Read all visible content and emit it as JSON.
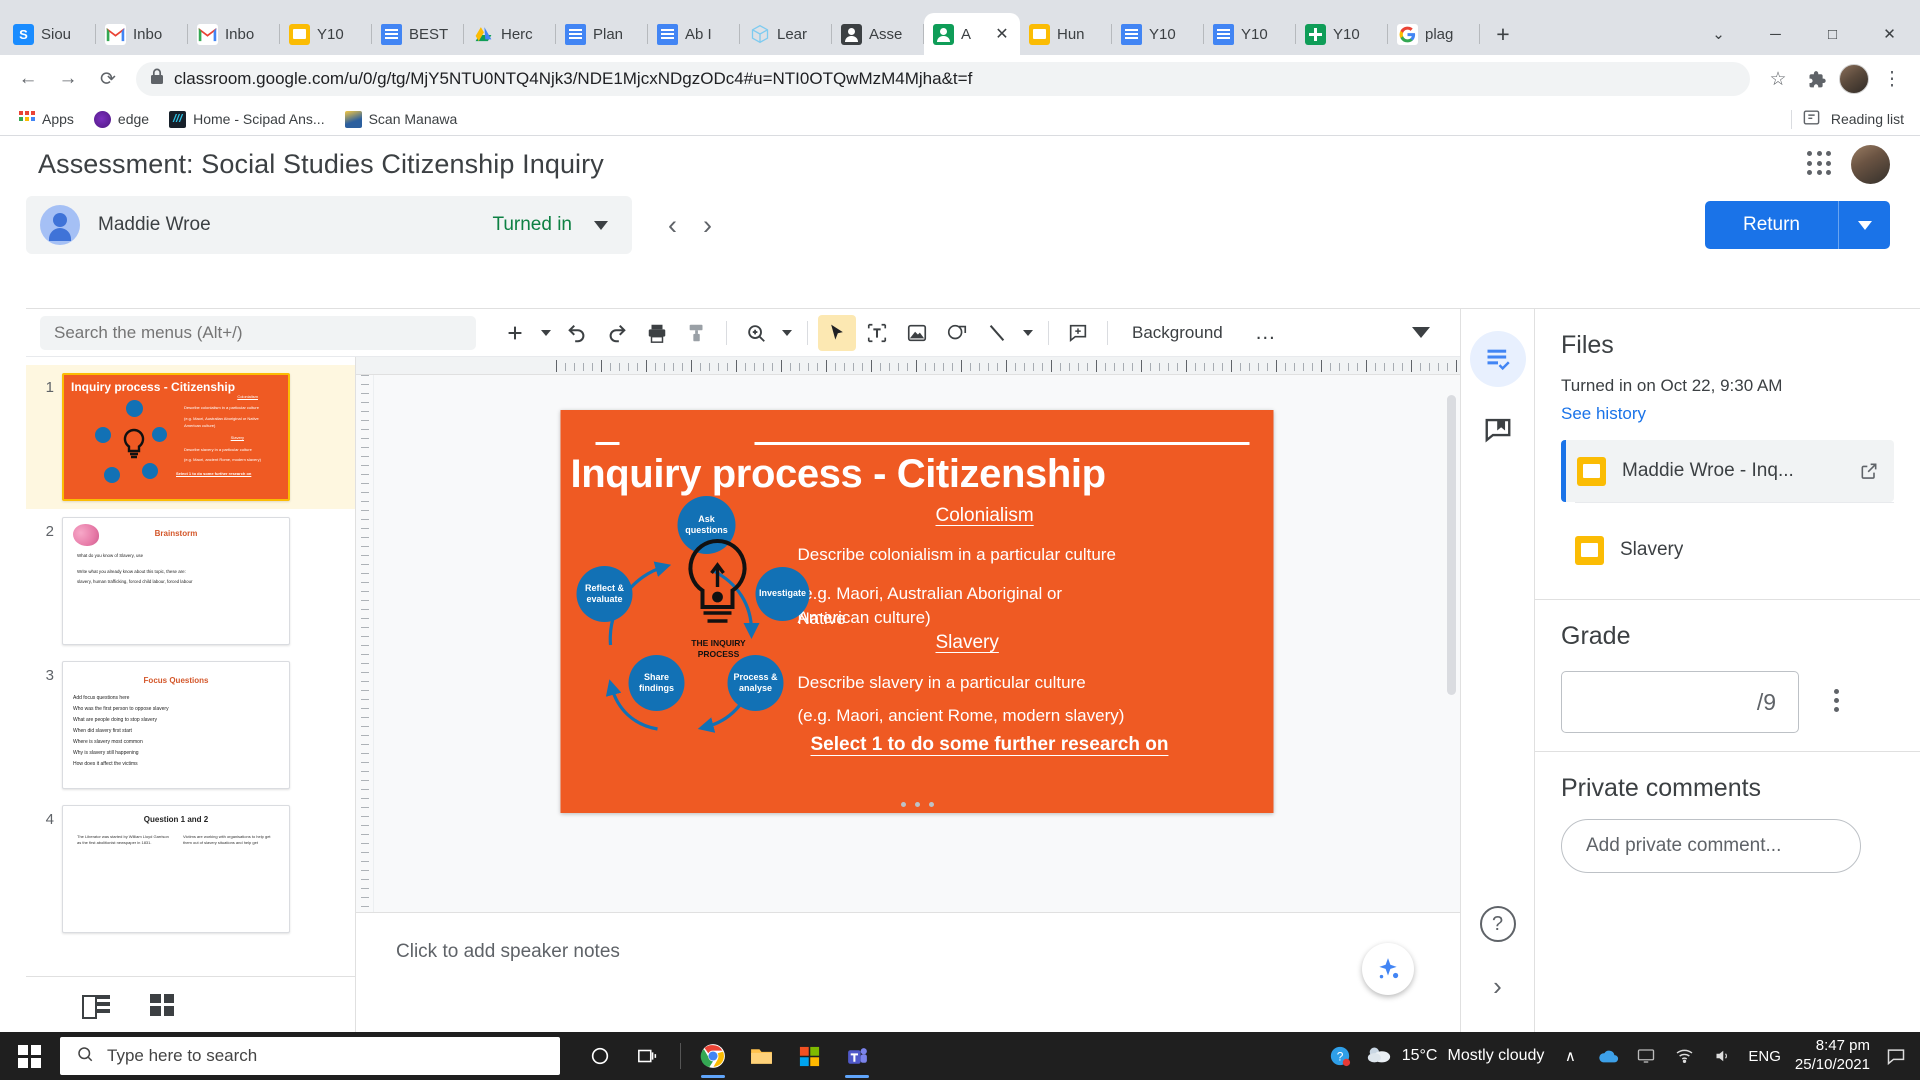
{
  "browser": {
    "tabs": [
      {
        "label": "Siou",
        "icon": "snipping-tool-icon",
        "kind": "snip",
        "active": false
      },
      {
        "label": "Inbo",
        "icon": "gmail-icon",
        "kind": "gmail",
        "active": false
      },
      {
        "label": "Inbo",
        "icon": "gmail-icon",
        "kind": "gmail",
        "active": false
      },
      {
        "label": "Y10",
        "icon": "google-slides-icon",
        "kind": "slides",
        "active": false
      },
      {
        "label": "BEST",
        "icon": "google-docs-icon",
        "kind": "docs",
        "active": false
      },
      {
        "label": "Herc",
        "icon": "google-drive-icon",
        "kind": "drive",
        "active": false
      },
      {
        "label": "Plan",
        "icon": "google-docs-icon",
        "kind": "docs",
        "active": false
      },
      {
        "label": "Ab I",
        "icon": "google-docs-icon",
        "kind": "docs",
        "active": false
      },
      {
        "label": "Lear",
        "icon": "cube-icon",
        "kind": "cube",
        "active": false
      },
      {
        "label": "Asse",
        "icon": "google-classroom-icon",
        "kind": "classroom-grey",
        "active": false
      },
      {
        "label": "A",
        "icon": "google-classroom-icon",
        "kind": "classroom",
        "active": true
      },
      {
        "label": "Hun",
        "icon": "google-slides-icon",
        "kind": "slides",
        "active": false
      },
      {
        "label": "Y10",
        "icon": "google-docs-icon",
        "kind": "docs",
        "active": false
      },
      {
        "label": "Y10",
        "icon": "google-docs-icon",
        "kind": "docs",
        "active": false
      },
      {
        "label": "Y10",
        "icon": "google-sheets-icon",
        "kind": "sheets",
        "active": false
      },
      {
        "label": "plag",
        "icon": "google-search-icon",
        "kind": "google",
        "active": false
      }
    ],
    "new_tab_label": "+",
    "window_controls": {
      "minimize": "─",
      "maximize": "□",
      "close": "✕",
      "chevron": "⌄"
    },
    "url": "classroom.google.com/u/0/g/tg/MjY5NTU0NTQ4Njk3/NDE1MjcxNDgzODc4#u=NTI0OTQwMzM4Mjha&t=f",
    "lock_icon": "lock-icon",
    "back_icon": "←",
    "forward_icon": "→",
    "reload_icon": "⟳",
    "star_icon": "☆",
    "extensions_icon": "puzzle-icon",
    "menu_icon": "⋮",
    "bookmarks": [
      {
        "label": "Apps",
        "icon": "apps-grid-icon"
      },
      {
        "label": "edge",
        "icon": "edge-icon"
      },
      {
        "label": "Home - Scipad Ans...",
        "icon": "scipad-icon"
      },
      {
        "label": "Scan Manawa",
        "icon": "scan-manawa-icon"
      }
    ],
    "reading_list_label": "Reading list",
    "reading_list_icon": "reading-list-icon"
  },
  "classroom": {
    "title": "Assessment: Social Studies Citizenship Inquiry",
    "apps_icon": "google-apps-grid-icon",
    "account_avatar": "account-avatar",
    "student": {
      "name": "Maddie Wroe",
      "status": "Turned in",
      "status_color": "#0d8043",
      "avatar": "student-avatar"
    },
    "prev_icon": "‹",
    "next_icon": "›",
    "return_label": "Return",
    "return_color": "#1a73e8"
  },
  "slides": {
    "search_placeholder": "Search the menus (Alt+/)",
    "toolbar": {
      "add_label": "+",
      "undo_icon": "undo-icon",
      "redo_icon": "redo-icon",
      "print_icon": "print-icon",
      "paint_format_icon": "paint-format-icon",
      "zoom_icon": "zoom-icon",
      "select_icon": "select-cursor-icon",
      "textbox_icon": "text-box-icon",
      "image_icon": "insert-image-icon",
      "shape_icon": "insert-shape-icon",
      "line_icon": "insert-line-icon",
      "comment_icon": "add-comment-icon",
      "background_label": "Background",
      "more_label": "…",
      "collapse_icon": "chevron-down-icon"
    },
    "thumbnails": [
      {
        "number": "1",
        "selected": true,
        "kind": "slide1",
        "title": "Inquiry process - Citizenship",
        "sub": "Colonialism",
        "lines": [
          "Describe colonialism in a particular culture",
          "(e.g. Maori, Australian Aboriginal or Native",
          "American culture)",
          "Slavery",
          "Describe slavery in a particular culture",
          "(e.g. Maori, ancient Rome, modern slavery)",
          "Select 1 to do some further research on"
        ],
        "nodes": [
          "Ask questions",
          "Investigate",
          "Process & analyse",
          "Share findings",
          "Reflect & evaluate"
        ]
      },
      {
        "number": "2",
        "selected": false,
        "kind": "slide2",
        "title": "Brainstorm",
        "lines": [
          "What do you know of Slavery, use",
          "Write what you already know about this topic, these are:",
          "slavery, human trafficking, forced child labour, forced labour"
        ]
      },
      {
        "number": "3",
        "selected": false,
        "kind": "slide3",
        "title": "Focus Questions",
        "lines": [
          "Add focus questions here",
          "Who was the first person to oppose slavery",
          "What are people doing to stop slavery",
          "When did slavery first start",
          "Where is slavery most common",
          "Why is slavery still happening",
          "How does it affect the victims"
        ]
      },
      {
        "number": "4",
        "selected": false,
        "kind": "slide4",
        "title": "Question 1 and 2",
        "col_left": "The Liberator was started by William Lloyd Garrison as the first abolitionist newspaper in 1831.",
        "col_right": "Victims are working with organisations to help get them out of slavery situations and help get"
      }
    ],
    "slide": {
      "title": "Inquiry process - Citizenship",
      "heading1": "Colonialism",
      "para1": "Describe colonialism in a particular culture",
      "para2": "(e.g. Maori, Australian Aboriginal or Native",
      "para2b": "American culture)",
      "heading2": "Slavery",
      "para3": "Describe slavery in a particular culture",
      "para4": "(e.g. Maori, ancient Rome, modern slavery)",
      "cta": "Select 1 to do some further research on",
      "nodes": [
        {
          "label": "Ask questions"
        },
        {
          "label": "Investigate"
        },
        {
          "label": "Process & analyse"
        },
        {
          "label": "Share findings"
        },
        {
          "label": "Reflect & evaluate"
        }
      ],
      "center_label": "THE INQUIRY PROCESS",
      "bg_color": "#ef5a23",
      "node_color": "#1271b5"
    },
    "notes_placeholder": "Click to add speaker notes",
    "explore_icon": "explore-icon",
    "filmstrip_mode_icon": "filmstrip-view-icon",
    "grid_mode_icon": "grid-view-icon"
  },
  "sidebar": {
    "rail": {
      "document_icon": "document-checklist-icon",
      "comment_icon": "comment-bank-icon",
      "help_icon": "help-icon",
      "expand_icon": "chevron-right-icon"
    },
    "files": {
      "heading": "Files",
      "turned_in_text": "Turned in on Oct 22, 9:30 AM",
      "history_link": "See history",
      "items": [
        {
          "name": "Maddie Wroe - Inq...",
          "icon": "google-slides-file-icon",
          "selected": true,
          "open_icon": "open-in-new-icon"
        },
        {
          "name": "Slavery",
          "icon": "google-slides-file-icon",
          "selected": false,
          "open_icon": ""
        }
      ]
    },
    "grade": {
      "heading": "Grade",
      "value": "",
      "denominator": "/9",
      "kebab_icon": "more-options-icon"
    },
    "private_comments": {
      "heading": "Private comments",
      "placeholder": "Add private comment..."
    }
  },
  "taskbar": {
    "start_icon": "windows-start-icon",
    "search_placeholder": "Type here to search",
    "search_icon": "search-icon",
    "icons": [
      {
        "name": "cortana-icon",
        "running": false
      },
      {
        "name": "task-view-icon",
        "running": false
      },
      {
        "name": "chrome-icon",
        "running": true
      },
      {
        "name": "file-explorer-icon",
        "running": false
      },
      {
        "name": "microsoft-store-icon",
        "running": false
      },
      {
        "name": "microsoft-teams-icon",
        "running": true
      }
    ],
    "help_icon": "help-circle-icon",
    "weather": {
      "icon": "cloud-icon",
      "temp": "15°C",
      "desc": "Mostly cloudy"
    },
    "tray": {
      "chevron": "∧",
      "icons": [
        "onedrive-icon",
        "display-icon",
        "wifi-icon",
        "volume-icon"
      ],
      "language": "ENG"
    },
    "clock": {
      "time": "8:47 pm",
      "date": "25/10/2021"
    },
    "notification_icon": "notification-icon"
  }
}
